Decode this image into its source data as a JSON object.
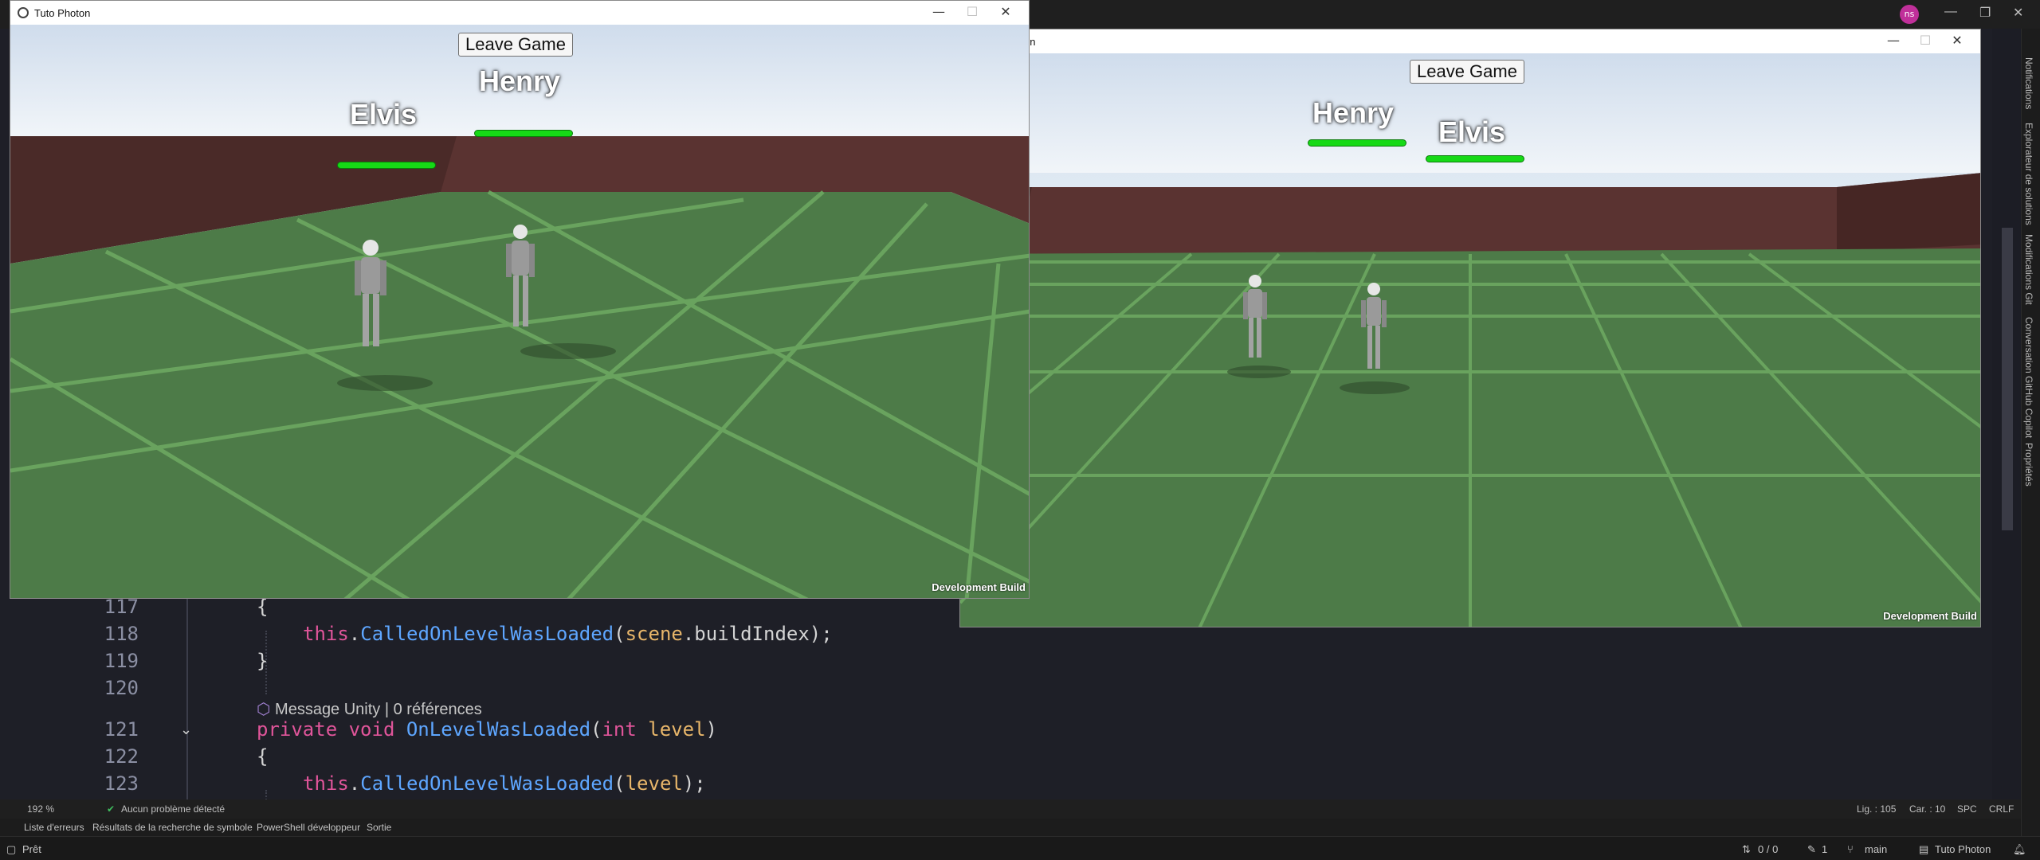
{
  "ide": {
    "avatar_initials": "ns",
    "code_lines": [
      {
        "num": "117",
        "code": "{"
      },
      {
        "num": "118",
        "code": "this.CalledOnLevelWasLoaded(scene.buildIndex);"
      },
      {
        "num": "119",
        "code": "}"
      },
      {
        "num": "120",
        "code": ""
      },
      {
        "num": "121",
        "code": "private void OnLevelWasLoaded(int level)"
      },
      {
        "num": "122",
        "code": "{"
      },
      {
        "num": "123",
        "code": "this.CalledOnLevelWasLoaded(level);"
      }
    ],
    "codelens": {
      "msg": "Message Unity",
      "refs": "0 références"
    },
    "right_tabs": [
      "Notifications",
      "Explorateur de solutions",
      "Modifications Git",
      "Conversation GitHub Copilot",
      "Propriétés"
    ],
    "editor_status": {
      "zoom": "192 %",
      "problems": "Aucun problème détecté",
      "line": "Lig. : 105",
      "char": "Car. : 10",
      "spc": "SPC",
      "crlf": "CRLF"
    },
    "tool_tabs": [
      "Liste d'erreurs",
      "Résultats de la recherche de symbole",
      "PowerShell développeur",
      "Sortie"
    ],
    "status_bar": {
      "ready": "Prêt",
      "changes": "0 / 0",
      "commits": "1",
      "branch": "main",
      "project": "Tuto Photon"
    }
  },
  "window_left": {
    "title": "Tuto Photon",
    "leave_label": "Leave Game",
    "players": [
      {
        "name": "Elvis"
      },
      {
        "name": "Henry"
      }
    ],
    "dev_build": "Development Build"
  },
  "window_right": {
    "title": "on",
    "leave_label": "Leave Game",
    "players": [
      {
        "name": "Henry"
      },
      {
        "name": "Elvis"
      }
    ],
    "dev_build": "Development Build"
  },
  "colors": {
    "floor": "#4c7a47",
    "wall": "#5a3331",
    "health": "#16d916",
    "keyword": "#e0559a",
    "method": "#5ea6ff"
  }
}
